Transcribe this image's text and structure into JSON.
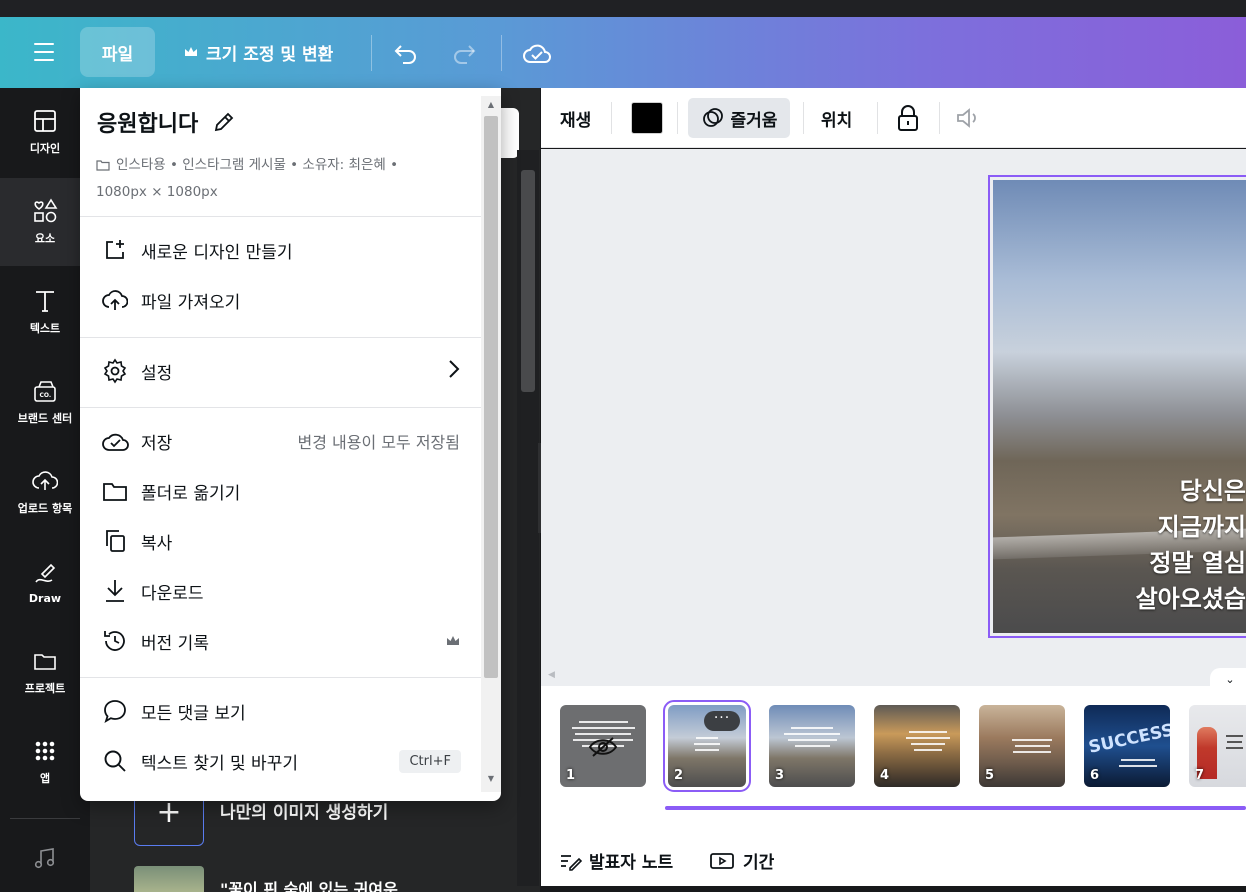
{
  "header": {
    "file_label": "파일",
    "resize_label": "크기 조정 및 변환"
  },
  "rail": {
    "items": [
      {
        "label": "디자인",
        "icon": "layout-icon"
      },
      {
        "label": "요소",
        "icon": "shapes-icon"
      },
      {
        "label": "텍스트",
        "icon": "text-icon"
      },
      {
        "label": "브랜드 센터",
        "icon": "brand-icon"
      },
      {
        "label": "업로드 항목",
        "icon": "upload-icon"
      },
      {
        "label": "Draw",
        "icon": "draw-icon"
      },
      {
        "label": "프로젝트",
        "icon": "folder-icon"
      },
      {
        "label": "앱",
        "icon": "apps-icon"
      }
    ]
  },
  "panel": {
    "generate_label": "나만의 이미지 생성하기",
    "next_item_label": "\"꽃이 핀 숲에 있는 귀여운"
  },
  "context_toolbar": {
    "play_label": "재생",
    "animation_label": "즐거움",
    "position_label": "위치",
    "swatch_color": "#000000"
  },
  "file_menu": {
    "title": "응원합니다",
    "meta_line1": "인스타용 • 인스타그램 게시물 • 소유자: 최은혜 •",
    "meta_line2": "1080px × 1080px",
    "items": {
      "new_design": "새로운 디자인 만들기",
      "import_file": "파일 가져오기",
      "settings": "설정",
      "save": "저장",
      "save_status": "변경 내용이 모두 저장됨",
      "move_folder": "폴더로 옮기기",
      "copy": "복사",
      "download": "다운로드",
      "version_history": "버전 기록",
      "view_comments": "모든 댓글 보기",
      "find_replace": "텍스트 찾기 및 바꾸기",
      "find_replace_shortcut": "Ctrl+F"
    }
  },
  "canvas": {
    "lines": [
      "당신은",
      "지금까지",
      "정말 열심",
      "살아오셨습"
    ]
  },
  "pages": {
    "thumbnails": [
      "1",
      "2",
      "3",
      "4",
      "5",
      "6",
      "7"
    ],
    "selected": "2",
    "more_label": "···",
    "thumb6_text": "SUCCESS"
  },
  "footer": {
    "notes_label": "발표자 노트",
    "duration_label": "기간"
  },
  "colors": {
    "accent": "#8b5cf6",
    "header_start": "#3bb7c9",
    "header_end": "#8b5ed9"
  }
}
